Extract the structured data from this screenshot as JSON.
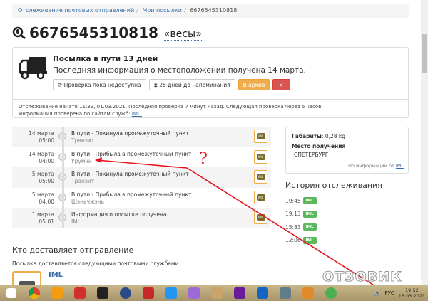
{
  "breadcrumb": {
    "items": [
      "Отслеживание почтовых отправлений",
      "Мои посылки"
    ],
    "current": "6676545310818"
  },
  "title": {
    "number": "6676545310818",
    "label": "«весы»"
  },
  "status": {
    "heading": "Посылка в пути 13 дней",
    "subheading": "Последняя информация о местоположении получена 14 марта.",
    "btn_check": "Проверка пока недоступна",
    "btn_remind": "28 дней до напоминания",
    "btn_archive": "В архив",
    "btn_delete": "×",
    "footer_line1": "Отслеживание начато 11:39, 01.03.2021. Последняя проверка 7 минут назад. Следующая проверка через 5 часов.",
    "footer_line2": "Информация проверена по сайтам служб: ",
    "footer_link": "IML."
  },
  "timeline": [
    {
      "date": "14 марта",
      "time": "05:00",
      "title": "В пути - Покинула промежуточный пункт",
      "place": "Транзит"
    },
    {
      "date": "14 марта",
      "time": "04:00",
      "title": "В пути - Прибыла в промежуточный пункт",
      "place": "Урумчи"
    },
    {
      "date": "5 марта",
      "time": "05:00",
      "title": "В пути - Покинула промежуточный пункт",
      "place": "Транзит"
    },
    {
      "date": "5 марта",
      "time": "04:00",
      "title": "В пути - Прибыла в промежуточный пункт",
      "place": "Шэньчжэнь"
    },
    {
      "date": "1 марта",
      "time": "05:01",
      "title": "Информация о посылке получена",
      "place": "IML"
    }
  ],
  "carrier_icon_label": "IML",
  "info": {
    "size_label": "Габариты",
    "size_value": ": 0,28 kg",
    "dest_label": "Место получения",
    "dest_value": "СПЕТЕРБУРГ",
    "source_text": "По информации от ",
    "source_link": "IML"
  },
  "history": {
    "heading": "История отслеживания",
    "items": [
      {
        "time": "19:45",
        "badge": "IML"
      },
      {
        "time": "19:13",
        "badge": "IML"
      },
      {
        "time": "15:33",
        "badge": "IML"
      },
      {
        "time": "12:06",
        "badge": "IML"
      }
    ]
  },
  "delivery": {
    "heading": "Кто доставляет отправление",
    "text": "Посылка доставляется следующими почтовыми службами:",
    "carrier": "IML"
  },
  "annotation": {
    "mark": "?"
  },
  "watermark": "ОТЗОВИК",
  "taskbar": {
    "lang": "РУС",
    "time": "19:52",
    "date": "13.03.2021"
  }
}
